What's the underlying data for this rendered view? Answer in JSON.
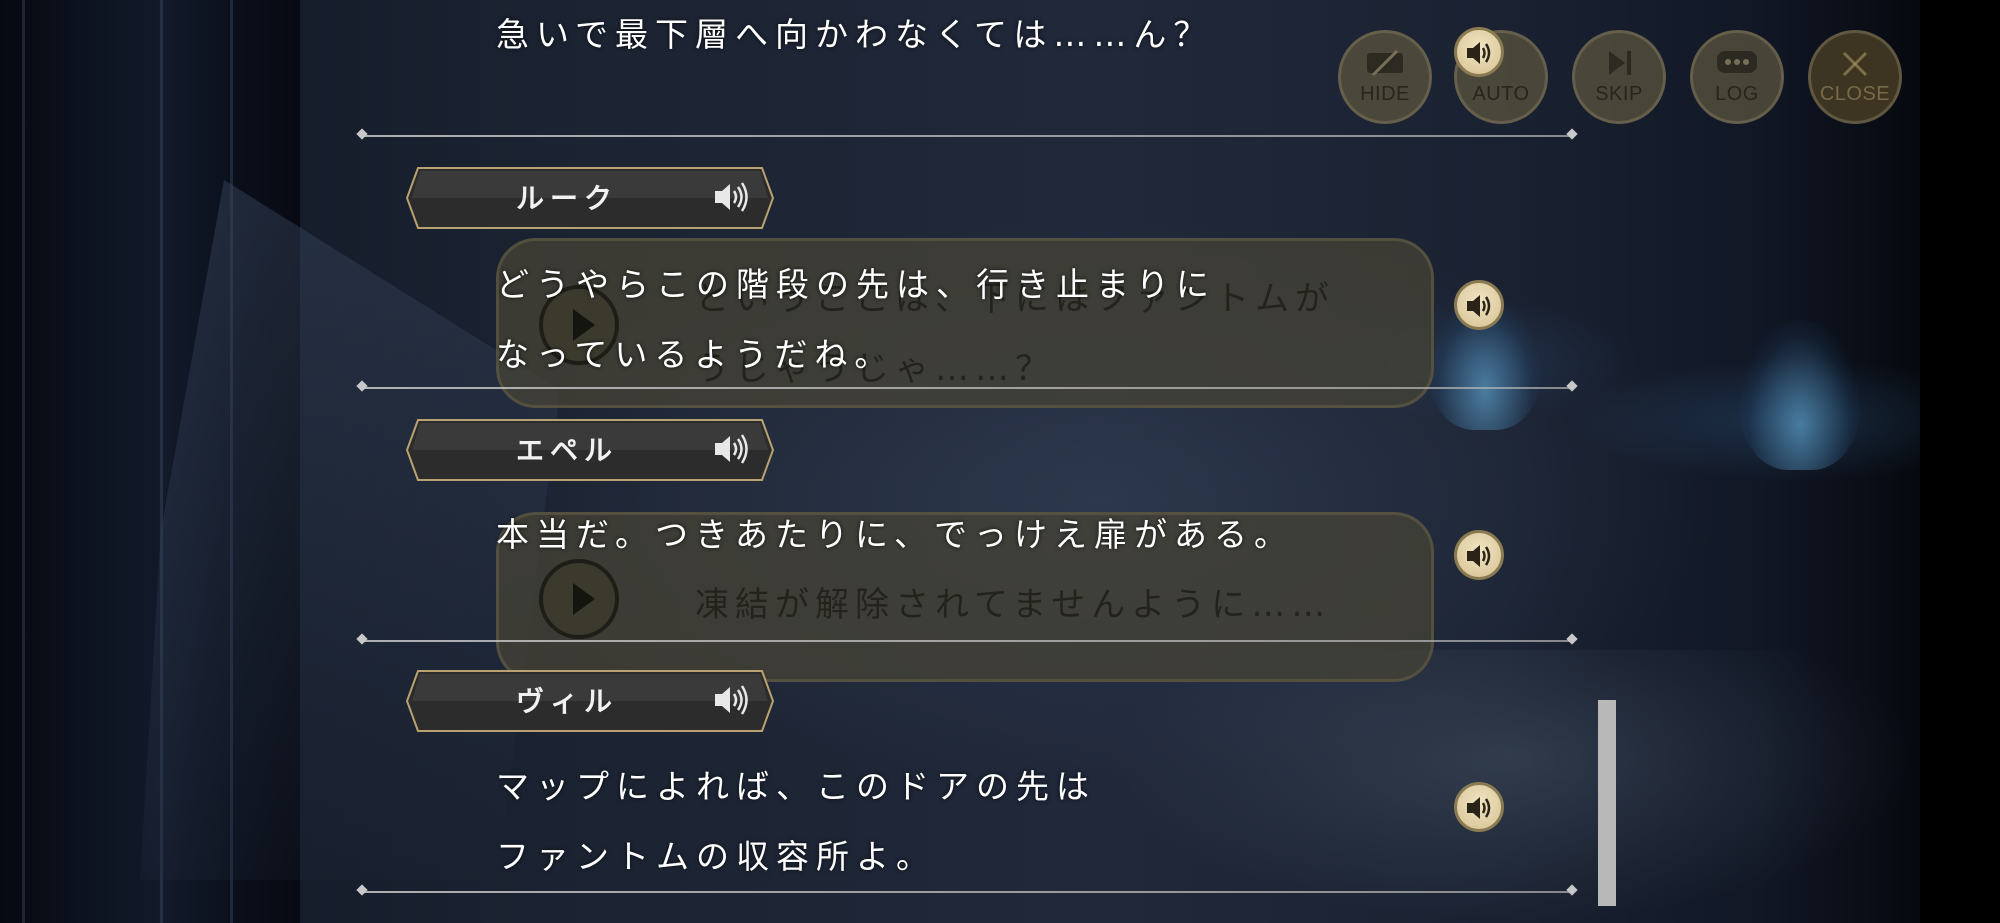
{
  "toolbar": {
    "hide_label": "HIDE",
    "auto_label": "AUTO",
    "skip_label": "SKIP",
    "log_label": "LOG",
    "close_label": "CLOSE"
  },
  "ghost": {
    "bubble1_line1": "というここは、下にはファントムが",
    "bubble1_line2": "うじゃうじゃ……？",
    "bubble2_line1": "凍結が解除されてませんように……"
  },
  "log": {
    "entries": [
      {
        "speaker": "",
        "lines": [
          "急いで最下層へ向かわなくては……ん？"
        ]
      },
      {
        "speaker": "ルーク",
        "lines": [
          "どうやらこの階段の先は、行き止まりに",
          "なっているようだね。"
        ]
      },
      {
        "speaker": "エペル",
        "lines": [
          "本当だ。つきあたりに、でっけえ扉がある。"
        ]
      },
      {
        "speaker": "ヴィル",
        "lines": [
          "マップによれば、このドアの先は",
          "ファントムの収容所よ。"
        ]
      }
    ]
  },
  "colors": {
    "nameplate_border": "#b9a270",
    "voice_button": "#e6d6ad",
    "text": "#ffffff"
  },
  "icons": {
    "speaker": "speaker-icon",
    "play": "play-icon",
    "hide": "hide-icon",
    "skip": "skip-icon",
    "log": "log-icon",
    "close": "close-icon"
  }
}
